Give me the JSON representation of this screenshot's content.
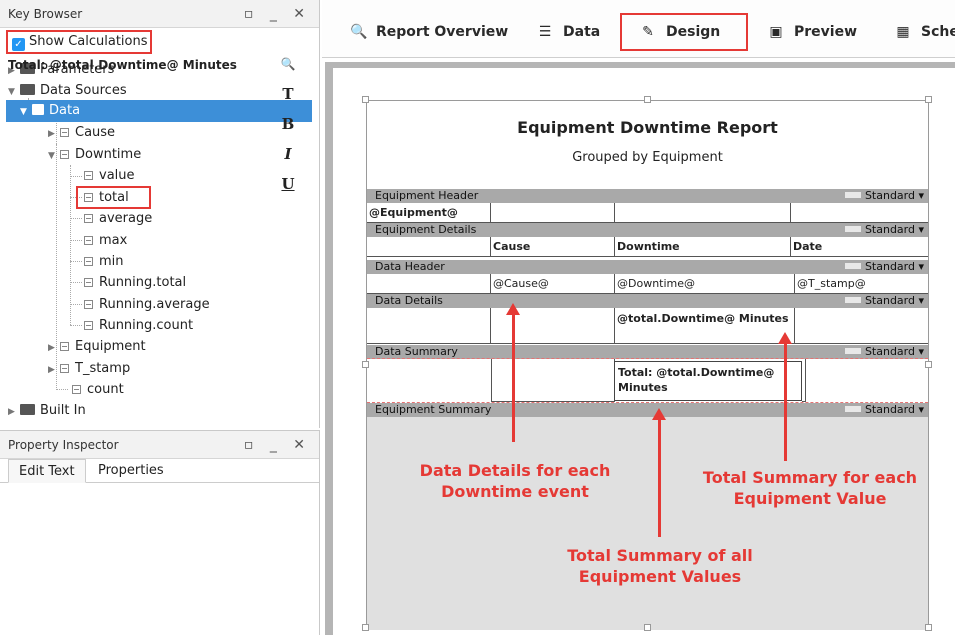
{
  "key_browser": {
    "title": "Key Browser",
    "controls": "▫ _ ✕",
    "show_calculations_label": "Show Calculations",
    "tree": {
      "parameters": "Parameters",
      "data_sources": "Data Sources",
      "data": "Data",
      "cause": "Cause",
      "downtime": "Downtime",
      "value": "value",
      "total": "total",
      "average": "average",
      "max": "max",
      "min": "min",
      "running_total": "Running.total",
      "running_average": "Running.average",
      "running_count": "Running.count",
      "equipment": "Equipment",
      "t_stamp": "T_stamp",
      "count": "count",
      "built_in": "Built In"
    }
  },
  "property_inspector": {
    "title": "Property Inspector",
    "controls": "▫ _ ✕",
    "tabs": {
      "edit_text": "Edit Text",
      "properties": "Properties"
    },
    "text": "Total: @total.Downtime@ Minutes",
    "tools": {
      "search": "🔍",
      "type": "T",
      "bold": "B",
      "italic": "I",
      "underline": "U"
    }
  },
  "toolbar": {
    "report_overview": "Report Overview",
    "data": "Data",
    "design": "Design",
    "preview": "Preview",
    "schedule": "Sche"
  },
  "report": {
    "title": "Equipment Downtime Report",
    "subtitle": "Grouped by Equipment",
    "bands": {
      "equipment_header": "Equipment Header",
      "equipment_details": "Equipment Details",
      "data_header": "Data Header",
      "data_details": "Data Details",
      "data_summary": "Data Summary",
      "equipment_summary": "Equipment Summary",
      "standard": "Standard ▾"
    },
    "cells": {
      "equipment": "@Equipment@",
      "cause_h": "Cause",
      "downtime_h": "Downtime",
      "date_h": "Date",
      "cause": "@Cause@",
      "downtime": "@Downtime@",
      "tstamp": "@T_stamp@",
      "total_detail": "@total.Downtime@ Minutes",
      "summary_line1": "Total: @total.Downtime@",
      "summary_line2": "Minutes"
    }
  },
  "annotations": {
    "data_details": [
      "Data Details for each",
      "Downtime event"
    ],
    "total_summary_each": [
      "Total Summary for each",
      "Equipment Value"
    ],
    "total_summary_all": [
      "Total Summary of all",
      "Equipment Values"
    ]
  },
  "colors": {
    "highlight_box": "#e53935",
    "selection": "#3d8fd8",
    "annotation": "#e53935"
  }
}
